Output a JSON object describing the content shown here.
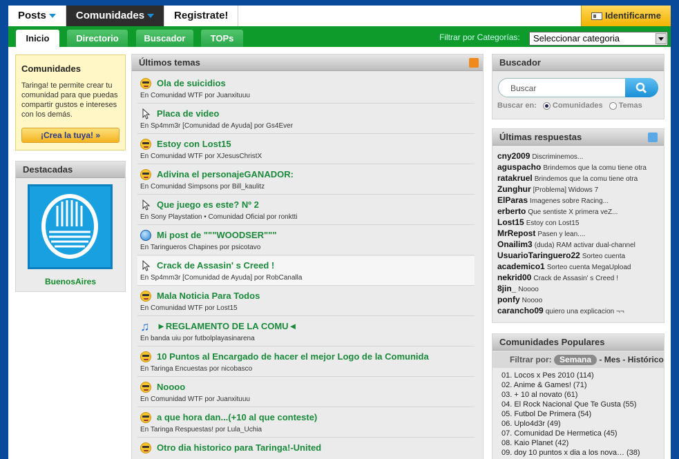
{
  "top_tabs": [
    {
      "label": "Posts"
    },
    {
      "label": "Comunidades"
    },
    {
      "label": "Registrate!"
    }
  ],
  "login": {
    "label": "Identificarme"
  },
  "sub_tabs": [
    "Inicio",
    "Directorio",
    "Buscador",
    "TOPs"
  ],
  "filter": {
    "label": "Filtrar por Categorías:",
    "selected": "Seleccionar categoria"
  },
  "info": {
    "title": "Comunidades",
    "text": "Taringa! te permite crear tu comunidad para que puedas compartir gustos e intereses con los demás.",
    "button": "¡Crea la tuya! »"
  },
  "featured": {
    "title": "Destacadas",
    "name": "BuenosAires"
  },
  "latest": {
    "title": "Últimos temas",
    "topics": [
      {
        "icon": "smiley-icon",
        "title": "Ola de suicidios",
        "meta": "En Comunidad WTF por Juanxituuu"
      },
      {
        "icon": "cursor-icon",
        "title": "Placa de video",
        "meta": "En Sp4mm3r [Comunidad de Ayuda] por Gs4Ever"
      },
      {
        "icon": "smiley-icon",
        "title": "Estoy con Lost15",
        "meta": "En Comunidad WTF por XJesusChristX"
      },
      {
        "icon": "smiley-icon",
        "title": "Adivina el personajeGANADOR:",
        "meta": "En Comunidad Simpsons por Bill_kaulitz"
      },
      {
        "icon": "cursor-icon",
        "title": "Que juego es este? Nº 2",
        "meta": "En Sony Playstation • Comunidad Oficial por ronktti"
      },
      {
        "icon": "globe-icon",
        "title": "Mi post de \"\"\"WOODSER\"\"\"",
        "meta": "En Taringueros Chapines por psicotavo"
      },
      {
        "icon": "cursor-icon",
        "title": "Crack de Assasin' s Creed !",
        "meta": "En Sp4mm3r [Comunidad de Ayuda] por RobCanalla"
      },
      {
        "icon": "smiley-icon",
        "title": "Mala Noticia Para Todos",
        "meta": "En Comunidad WTF por Lost15"
      },
      {
        "icon": "music-note-icon",
        "title": "►REGLAMENTO DE LA COMU◄",
        "meta": "En banda uiu por futbolplayasinarena"
      },
      {
        "icon": "smiley-icon",
        "title": "10 Puntos al Encargado de hacer el mejor Logo de la Comunida",
        "meta": "En Taringa Encuestas por nicobasco"
      },
      {
        "icon": "smiley-icon",
        "title": "Noooo",
        "meta": "En Comunidad WTF por Juanxituuu"
      },
      {
        "icon": "smiley-icon",
        "title": "a que hora dan...(+10 al que conteste)",
        "meta": "En Taringa Respuestas! por Lula_Uchia"
      },
      {
        "icon": "smiley-icon",
        "title": "Otro dia historico para Taringa!-United",
        "meta": ""
      }
    ]
  },
  "search": {
    "title": "Buscador",
    "placeholder": "Buscar",
    "in_label": "Buscar en:",
    "opt1": "Comunidades",
    "opt2": "Temas"
  },
  "replies": {
    "title": "Últimas respuestas",
    "items": [
      {
        "user": "cny2009",
        "text": "Discriminemos..."
      },
      {
        "user": "aguspacho",
        "text": "Brindemos que la comu tiene otra"
      },
      {
        "user": "ratakruel",
        "text": "Brindemos que la comu tiene otra"
      },
      {
        "user": "Zunghur",
        "text": "[Problema] Widows 7"
      },
      {
        "user": "ElParas",
        "text": "Imagenes sobre Racing..."
      },
      {
        "user": "erberto",
        "text": "Que sentiste X primera veZ..."
      },
      {
        "user": "Lost15",
        "text": "Estoy con Lost15"
      },
      {
        "user": "MrRepost",
        "text": "Pasen y lean...."
      },
      {
        "user": "Onailim3",
        "text": "(duda) RAM activar dual-channel"
      },
      {
        "user": "UsuarioTaringuero22",
        "text": "Sorteo cuenta"
      },
      {
        "user": "academico1",
        "text": "Sorteo cuenta MegaUpload"
      },
      {
        "user": "nekrid00",
        "text": "Crack de Assasin' s Creed !"
      },
      {
        "user": "8jin_",
        "text": "Noooo"
      },
      {
        "user": "ponfy",
        "text": "Noooo"
      },
      {
        "user": "carancho09",
        "text": "quiero una explicacion ¬¬"
      }
    ]
  },
  "popular": {
    "title": "Comunidades Populares",
    "filter_label": "Filtrar por:",
    "f_week": "Semana",
    "f_sep1": "-",
    "f_month": "Mes",
    "f_sep2": "-",
    "f_hist": "Histórico",
    "items": [
      "01.  Locos x Pes 2010 (114)",
      "02.  Anime & Games! (71)",
      "03.  + 10 al novato (61)",
      "04.  El Rock Nacional Que Te Gusta (55)",
      "05.  Futbol De Primera (54)",
      "06.  Uplo4d3r (49)",
      "07.  Comunidad De Hermetica (45)",
      "08.  Kaio Planet (42)",
      "09.  doy 10 puntos x dia a los nova… (38)"
    ]
  },
  "colors": {
    "green": "#0f9a2c",
    "link_green": "#1a8a3a",
    "blue_bg": "#0a4a9a",
    "yellow": "#f3b400"
  }
}
